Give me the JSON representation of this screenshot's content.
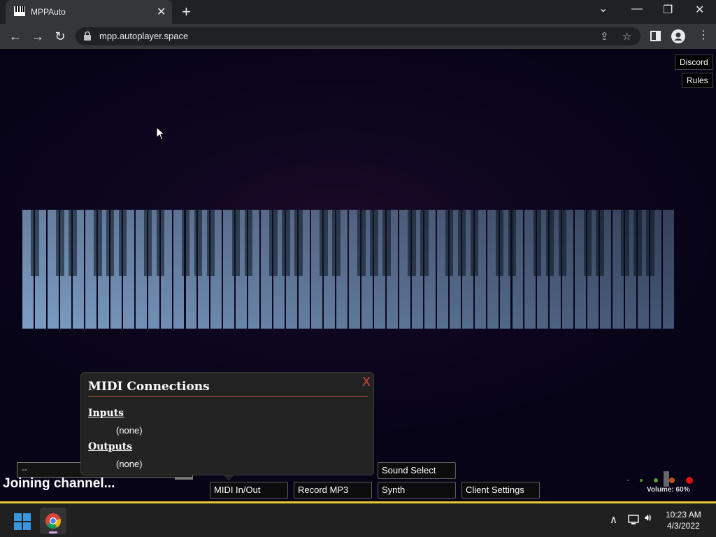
{
  "browser": {
    "tab_title": "MPPAuto",
    "tab_close": "✕",
    "new_tab": "+",
    "url": "mpp.autoplayer.space",
    "minimize": "—",
    "restore": "❐",
    "close": "✕",
    "dropdown": "⌄"
  },
  "page": {
    "discord_label": "Discord",
    "rules_label": "Rules",
    "midi_modal": {
      "title": "MIDI Connections",
      "close": "X",
      "inputs_label": "Inputs",
      "inputs_value": "(none)",
      "outputs_label": "Outputs",
      "outputs_value": "(none)"
    },
    "chat_input_value": "--",
    "status_text": "Joining channel...",
    "controls": {
      "midi_in_out": "MIDI In/Out",
      "record_mp3": "Record MP3",
      "sound_select": "Sound Select",
      "synth": "Synth",
      "client_settings": "Client Settings"
    },
    "volume_label": "Volume: 60%",
    "volume_percent": 60
  },
  "taskbar": {
    "time": "10:23 AM",
    "date": "4/3/2022"
  },
  "colors": {
    "accent_yellow": "#e6c830",
    "modal_close": "#d94b3e"
  }
}
